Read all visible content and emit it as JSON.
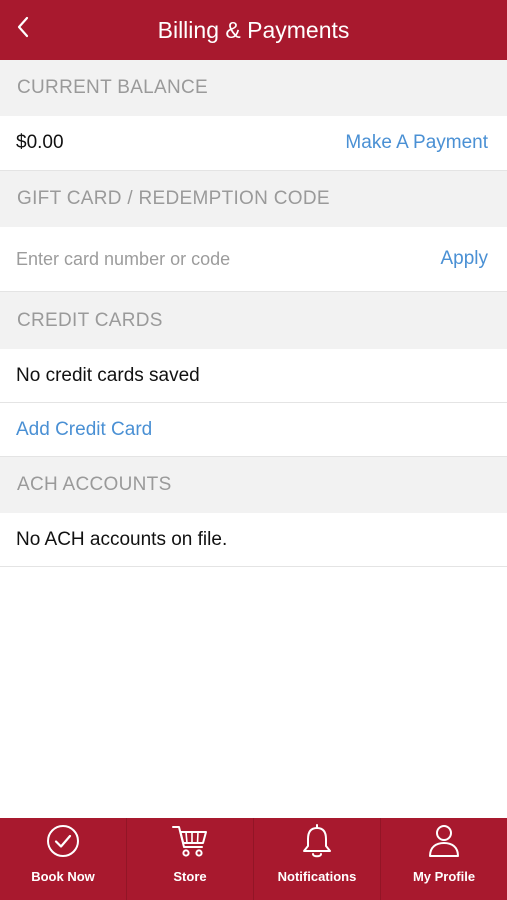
{
  "header": {
    "title": "Billing & Payments",
    "back_icon": "chevron-left-icon"
  },
  "balance": {
    "section_label": "CURRENT BALANCE",
    "amount": "$0.00",
    "action_label": "Make A Payment"
  },
  "gift_card": {
    "section_label": "GIFT CARD / REDEMPTION CODE",
    "placeholder": "Enter card number or code",
    "action_label": "Apply"
  },
  "credit_cards": {
    "section_label": "CREDIT CARDS",
    "empty_text": "No credit cards saved",
    "add_label": "Add Credit Card"
  },
  "ach": {
    "section_label": "ACH ACCOUNTS",
    "empty_text": "No ACH accounts on file."
  },
  "tabbar": {
    "items": [
      {
        "label": "Book Now",
        "icon": "check-circle-icon"
      },
      {
        "label": "Store",
        "icon": "cart-icon"
      },
      {
        "label": "Notifications",
        "icon": "bell-icon"
      },
      {
        "label": "My Profile",
        "icon": "user-icon"
      }
    ]
  },
  "colors": {
    "brand": "#a8192e",
    "link": "#4a90d4",
    "section_bg": "#f2f2f2",
    "section_text": "#9a9a9a"
  }
}
